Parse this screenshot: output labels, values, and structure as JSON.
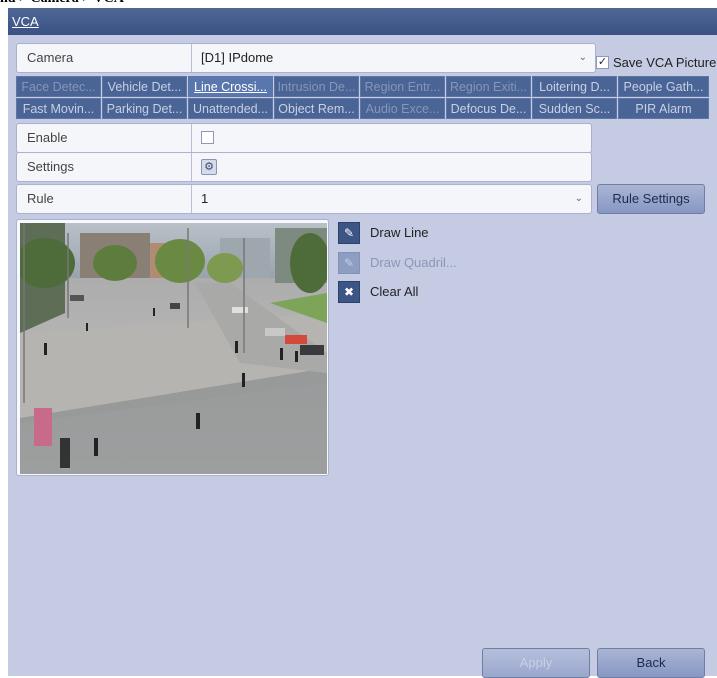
{
  "window": {
    "tab_title": "VCA"
  },
  "camera": {
    "label": "Camera",
    "value": "[D1] IPdome",
    "save_vca_label": "Save VCA Picture",
    "save_vca_checked": true
  },
  "vca_tabs": {
    "row1": [
      {
        "label": "Face Detec...",
        "state": "dim"
      },
      {
        "label": "Vehicle Det...",
        "state": "normal"
      },
      {
        "label": "Line Crossi...",
        "state": "active"
      },
      {
        "label": "Intrusion De...",
        "state": "dim"
      },
      {
        "label": "Region Entr...",
        "state": "dim"
      },
      {
        "label": "Region Exiti...",
        "state": "dim"
      },
      {
        "label": "Loitering D...",
        "state": "normal"
      },
      {
        "label": "People Gath...",
        "state": "normal"
      }
    ],
    "row2": [
      {
        "label": "Fast Movin...",
        "state": "normal"
      },
      {
        "label": "Parking Det...",
        "state": "normal"
      },
      {
        "label": "Unattended...",
        "state": "normal"
      },
      {
        "label": "Object Rem...",
        "state": "normal"
      },
      {
        "label": "Audio Exce...",
        "state": "dim"
      },
      {
        "label": "Defocus De...",
        "state": "normal"
      },
      {
        "label": "Sudden Sc...",
        "state": "normal"
      },
      {
        "label": "PIR Alarm",
        "state": "normal"
      }
    ]
  },
  "enable": {
    "label": "Enable",
    "checked": false
  },
  "settings": {
    "label": "Settings",
    "icon": "gear-icon"
  },
  "rule": {
    "label": "Rule",
    "value": "1",
    "settings_button": "Rule Settings"
  },
  "tools": {
    "draw_line": "Draw Line",
    "draw_quad": "Draw Quadril...",
    "clear_all": "Clear All"
  },
  "footer": {
    "apply": "Apply",
    "back": "Back"
  },
  "colors": {
    "titlebar": "#3a5283",
    "window_bg": "#c4cbe3",
    "tab_bg": "#4a6496"
  }
}
